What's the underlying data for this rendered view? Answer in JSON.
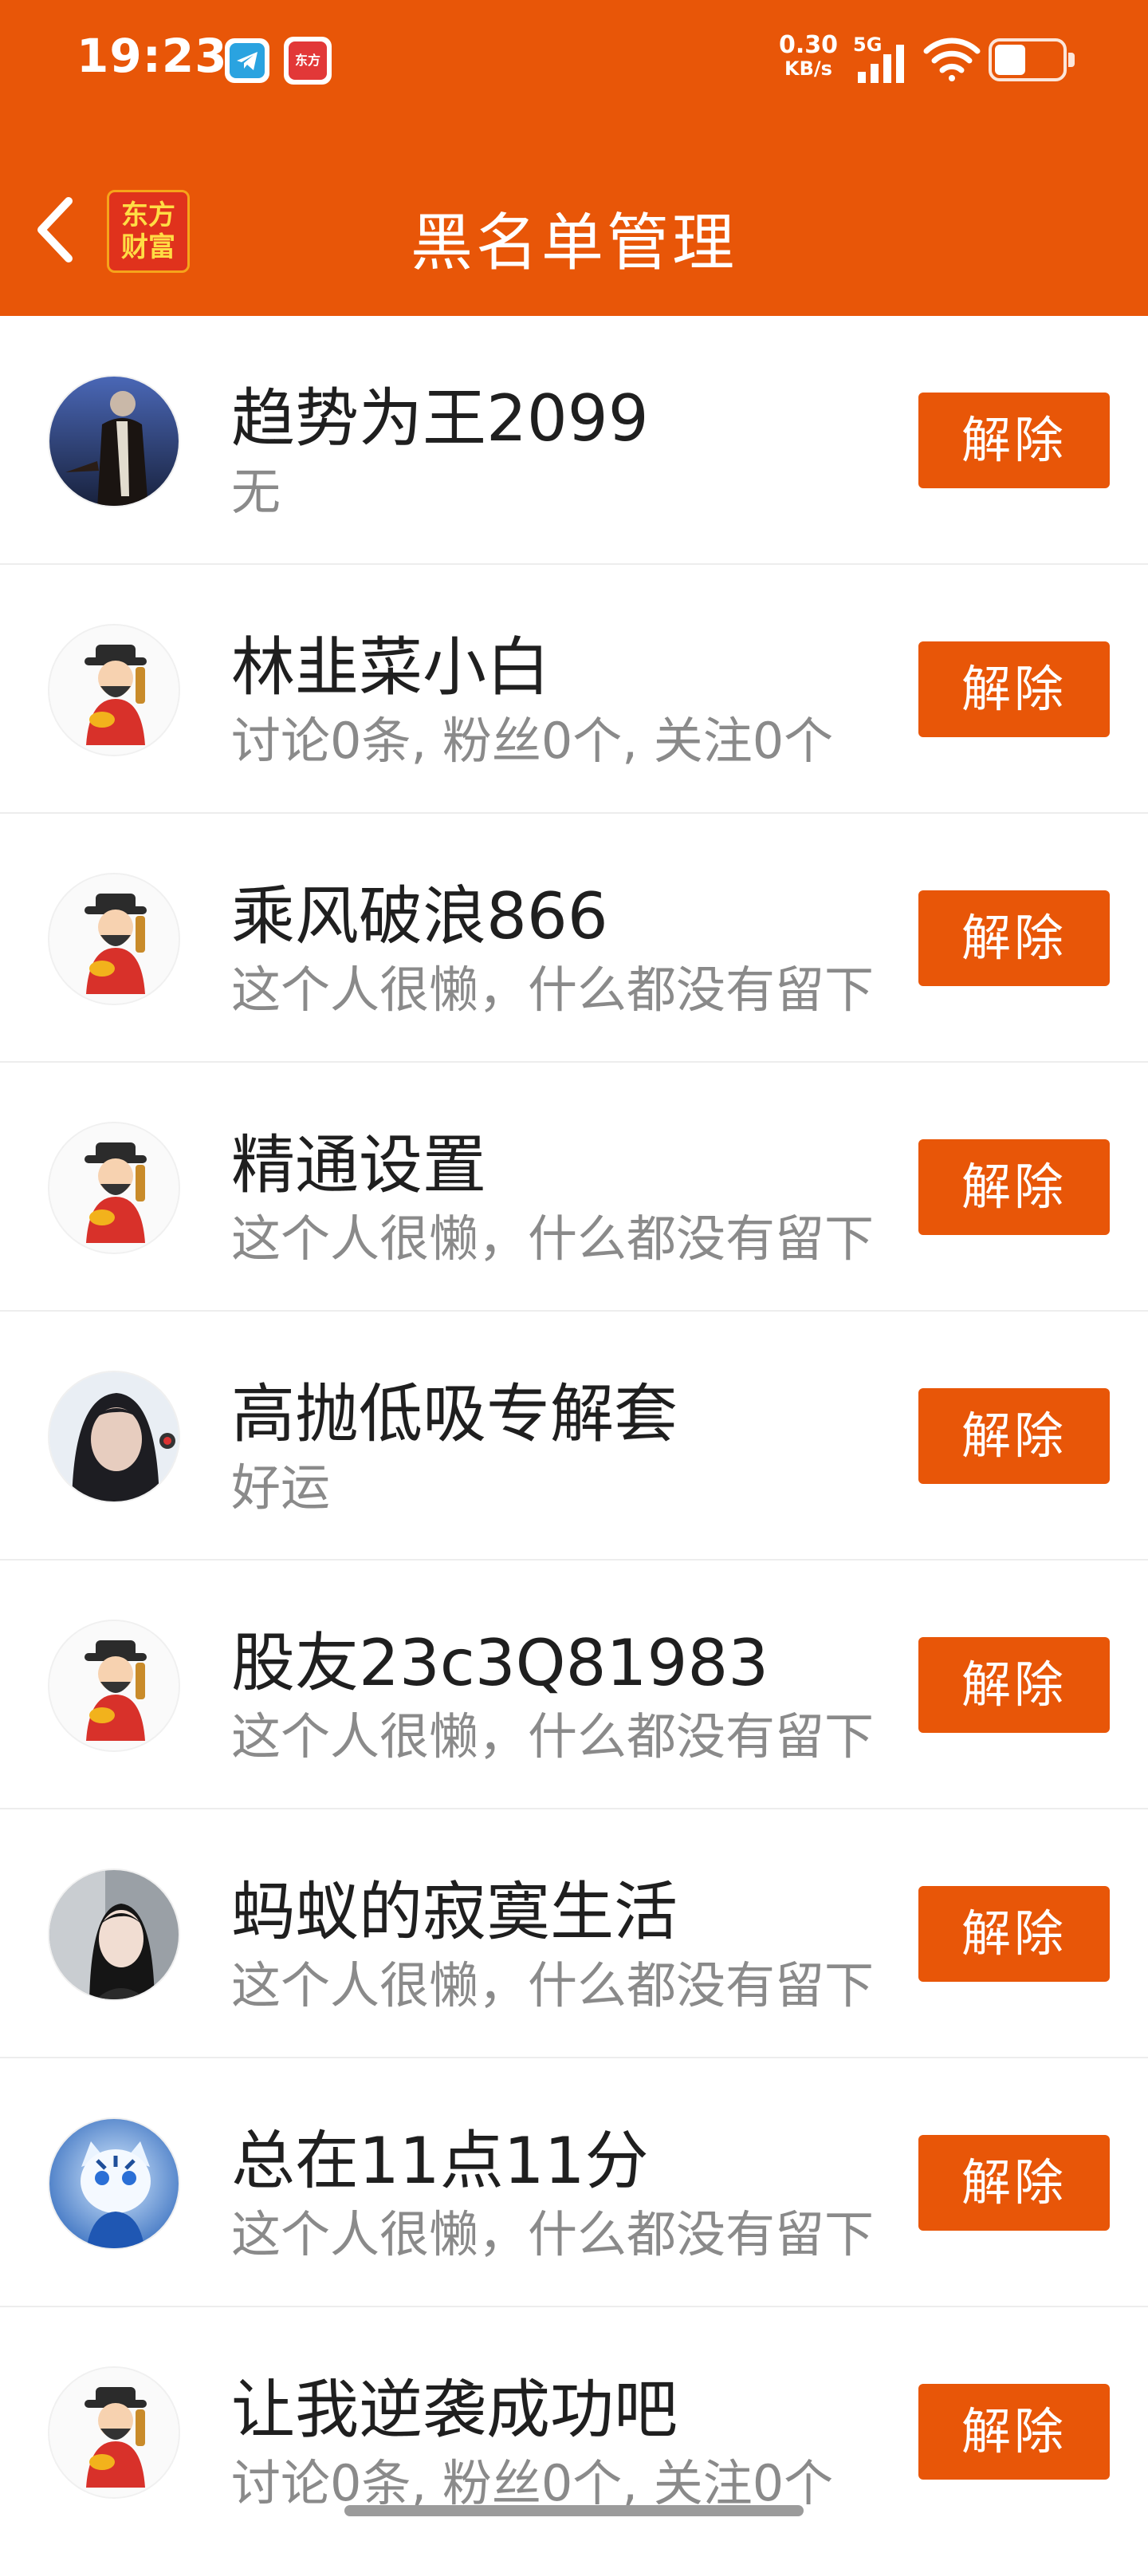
{
  "status_bar": {
    "time": "19:23",
    "brand_icon_text": "东方",
    "net_speed_value": "0.30",
    "net_speed_unit": "KB/s",
    "network_type": "5G"
  },
  "header": {
    "title": "黑名单管理",
    "logo_line1": "东方",
    "logo_line2": "财富",
    "accent_color": "#e85608"
  },
  "blacklist": [
    {
      "name": "趋势为王2099",
      "desc": "无",
      "action": "解除",
      "avatar": "photo-man-in-coat"
    },
    {
      "name": "林韭菜小白",
      "desc": "讨论0条, 粉丝0个, 关注0个",
      "action": "解除",
      "avatar": "god-of-wealth"
    },
    {
      "name": "乘风破浪866",
      "desc": "这个人很懒，什么都没有留下",
      "action": "解除",
      "avatar": "god-of-wealth"
    },
    {
      "name": "精通设置",
      "desc": "这个人很懒，什么都没有留下",
      "action": "解除",
      "avatar": "god-of-wealth"
    },
    {
      "name": "高抛低吸专解套",
      "desc": "好运",
      "action": "解除",
      "avatar": "photo-woman-portrait"
    },
    {
      "name": "股友23c3Q81983",
      "desc": "这个人很懒，什么都没有留下",
      "action": "解除",
      "avatar": "god-of-wealth"
    },
    {
      "name": "蚂蚁的寂寞生活",
      "desc": "这个人很懒，什么都没有留下",
      "action": "解除",
      "avatar": "photo-woman-car"
    },
    {
      "name": "总在11点11分",
      "desc": "这个人很懒，什么都没有留下",
      "action": "解除",
      "avatar": "blue-tiger"
    },
    {
      "name": "让我逆袭成功吧",
      "desc": "讨论0条, 粉丝0个, 关注0个",
      "action": "解除",
      "avatar": "god-of-wealth"
    }
  ]
}
